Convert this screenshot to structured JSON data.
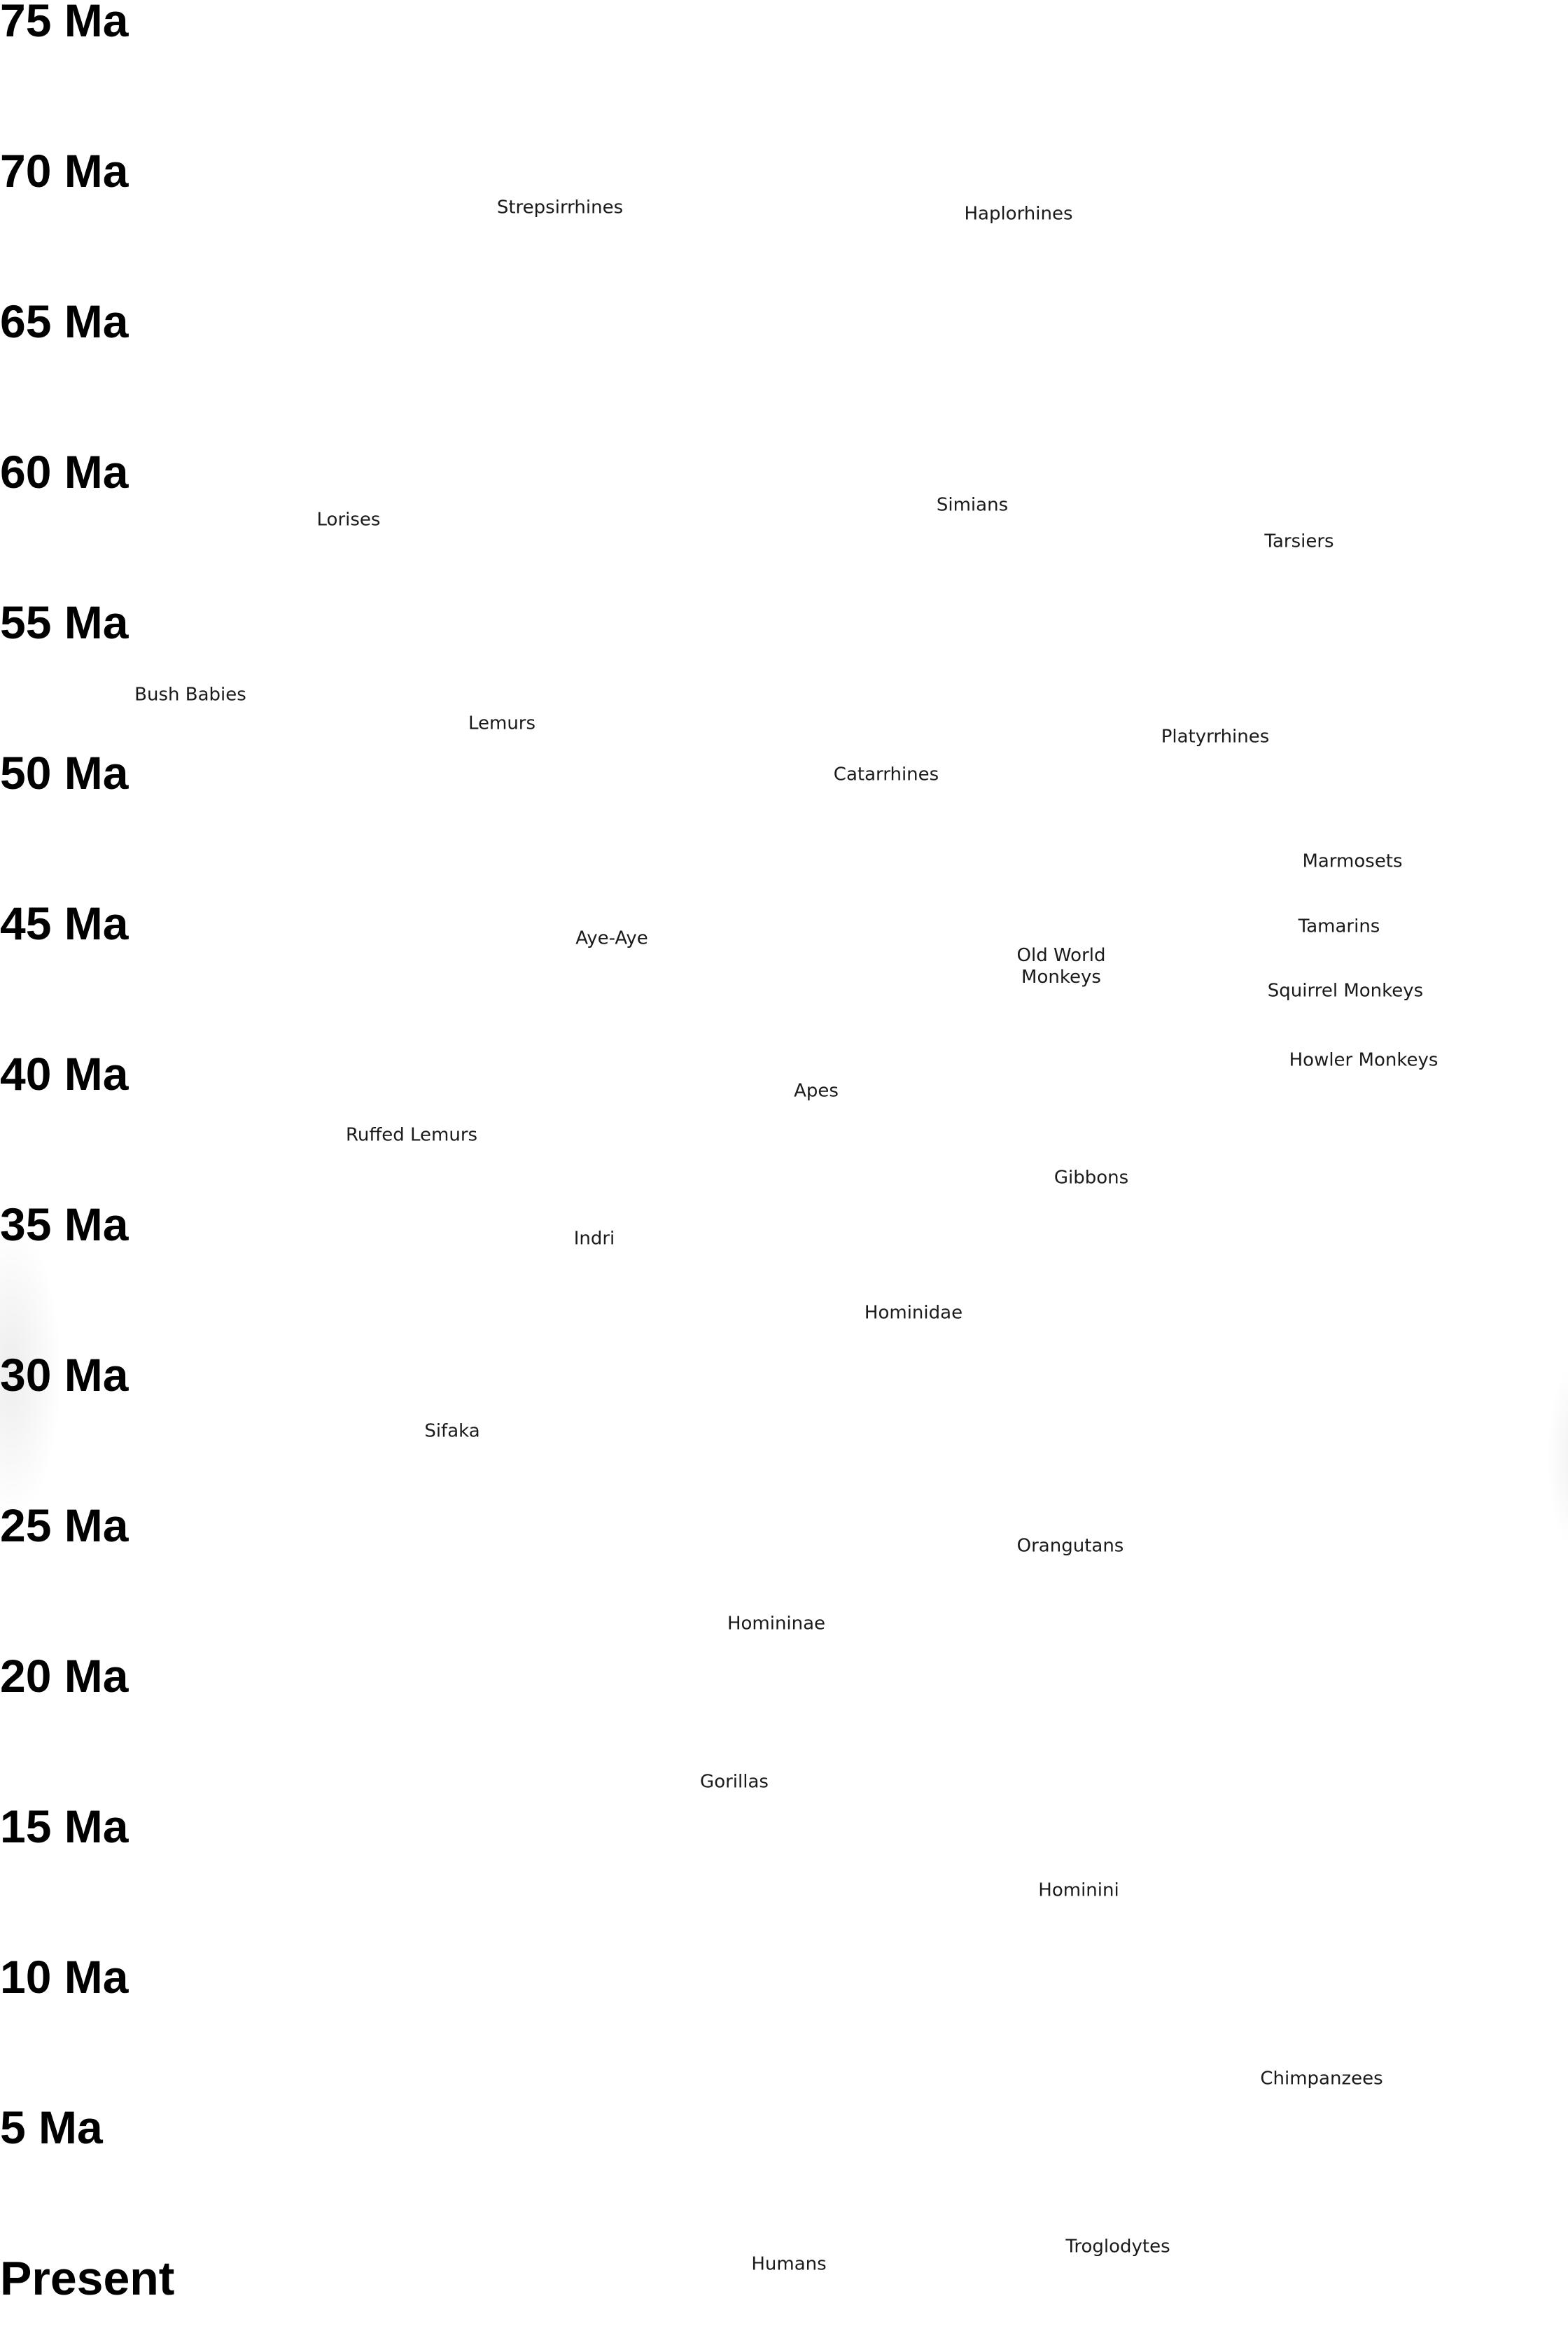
{
  "timeline": {
    "axis_labels": [
      "75 Ma",
      "70 Ma",
      "65 Ma",
      "60 Ma",
      "55 Ma",
      "50 Ma",
      "45 Ma",
      "40 Ma",
      "35 Ma",
      "30 Ma",
      "25 Ma",
      "20 Ma",
      "15 Ma",
      "10 Ma",
      "5 Ma",
      "Present"
    ]
  },
  "taxa": [
    {
      "id": "strepsirrhines",
      "lines": [
        "Strepsirrhines"
      ]
    },
    {
      "id": "haplorhines",
      "lines": [
        "Haplorhines"
      ]
    },
    {
      "id": "lorises",
      "lines": [
        "Lorises"
      ]
    },
    {
      "id": "simians",
      "lines": [
        "Simians"
      ]
    },
    {
      "id": "tarsiers",
      "lines": [
        "Tarsiers"
      ]
    },
    {
      "id": "bush-babies",
      "lines": [
        "Bush Babies"
      ]
    },
    {
      "id": "lemurs",
      "lines": [
        "Lemurs"
      ]
    },
    {
      "id": "platyrrhines",
      "lines": [
        "Platyrrhines"
      ]
    },
    {
      "id": "catarrhines",
      "lines": [
        "Catarrhines"
      ]
    },
    {
      "id": "marmosets",
      "lines": [
        "Marmosets"
      ]
    },
    {
      "id": "tamarins",
      "lines": [
        "Tamarins"
      ]
    },
    {
      "id": "aye-aye",
      "lines": [
        "Aye-Aye"
      ]
    },
    {
      "id": "old-world-monkeys",
      "lines": [
        "Old World",
        "Monkeys"
      ]
    },
    {
      "id": "squirrel-monkeys",
      "lines": [
        "Squirrel Monkeys"
      ]
    },
    {
      "id": "howler-monkeys",
      "lines": [
        "Howler Monkeys"
      ]
    },
    {
      "id": "apes",
      "lines": [
        "Apes"
      ]
    },
    {
      "id": "ruffed-lemurs",
      "lines": [
        "Ruffed Lemurs"
      ]
    },
    {
      "id": "gibbons",
      "lines": [
        "Gibbons"
      ]
    },
    {
      "id": "indri",
      "lines": [
        "Indri"
      ]
    },
    {
      "id": "hominidae",
      "lines": [
        "Hominidae"
      ]
    },
    {
      "id": "sifaka",
      "lines": [
        "Sifaka"
      ]
    },
    {
      "id": "orangutans",
      "lines": [
        "Orangutans"
      ]
    },
    {
      "id": "homininae",
      "lines": [
        "Homininae"
      ]
    },
    {
      "id": "gorillas",
      "lines": [
        "Gorillas"
      ]
    },
    {
      "id": "hominini",
      "lines": [
        "Hominini"
      ]
    },
    {
      "id": "chimpanzees",
      "lines": [
        "Chimpanzees"
      ]
    },
    {
      "id": "troglodytes",
      "lines": [
        "Troglodytes"
      ]
    },
    {
      "id": "humans",
      "lines": [
        "Humans"
      ]
    }
  ]
}
